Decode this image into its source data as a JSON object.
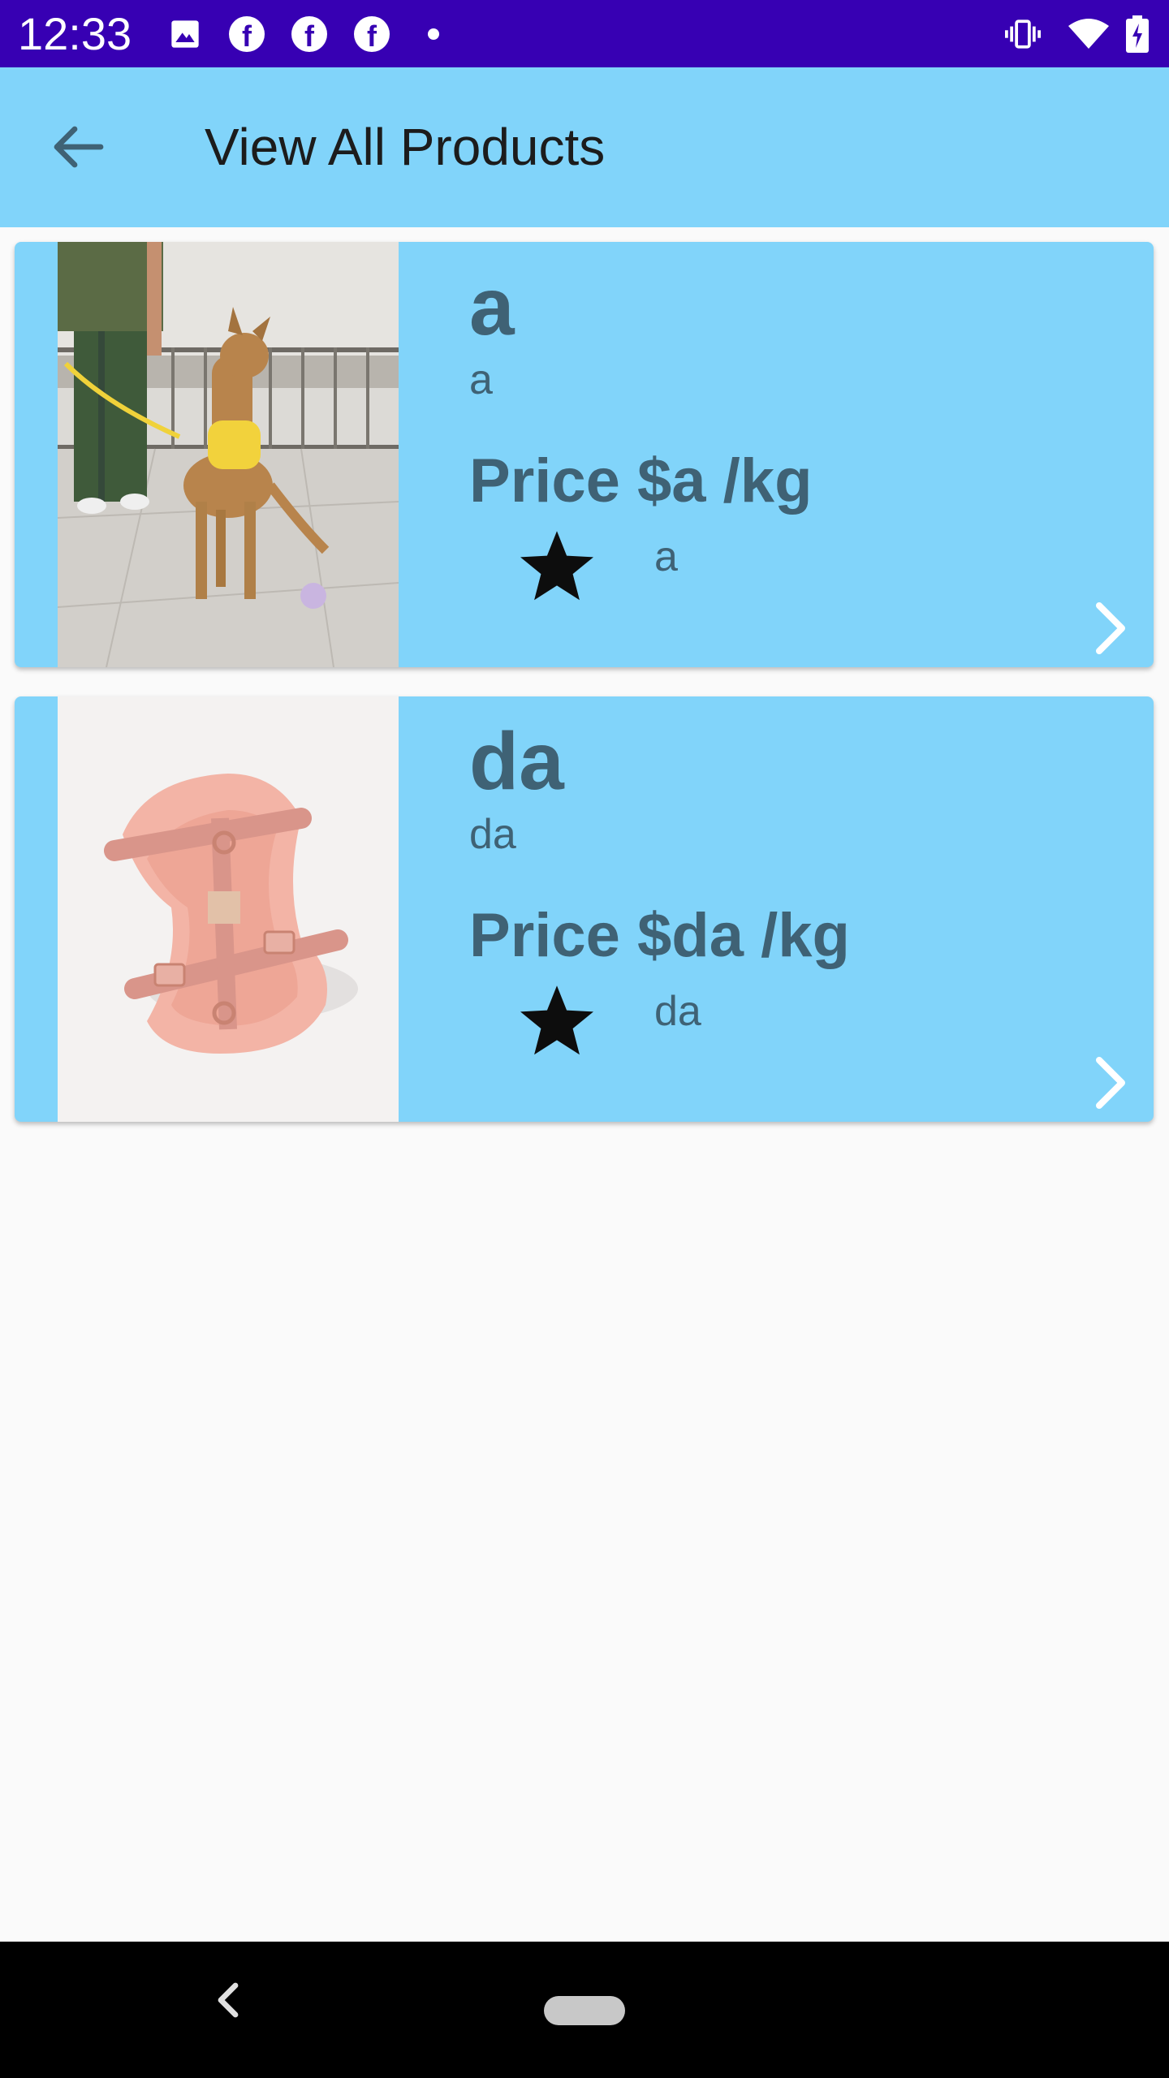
{
  "status_bar": {
    "time": "12:33",
    "notification_icons": [
      "image-icon",
      "facebook-icon",
      "facebook-icon",
      "facebook-icon",
      "dot-icon"
    ],
    "system_icons": [
      "vibrate-icon",
      "wifi-icon",
      "battery-charging-icon"
    ],
    "background": "#3700b3"
  },
  "app_bar": {
    "title": "View All Products",
    "back_icon": "arrow-back-icon",
    "background": "#81d4fa"
  },
  "products": [
    {
      "name": "a",
      "description": "a",
      "price": "Price $a /kg",
      "rating": "a",
      "image": "dog-with-yellow-harness"
    },
    {
      "name": "da",
      "description": "da",
      "price": "Price $da /kg",
      "rating": "da",
      "image": "pink-dog-harness"
    }
  ],
  "nav_bar": {
    "back_icon": "nav-back-icon",
    "home_icon": "home-pill-icon"
  },
  "colors": {
    "card": "#81d4fa",
    "text": "#3f6275",
    "page": "#fafafa"
  }
}
